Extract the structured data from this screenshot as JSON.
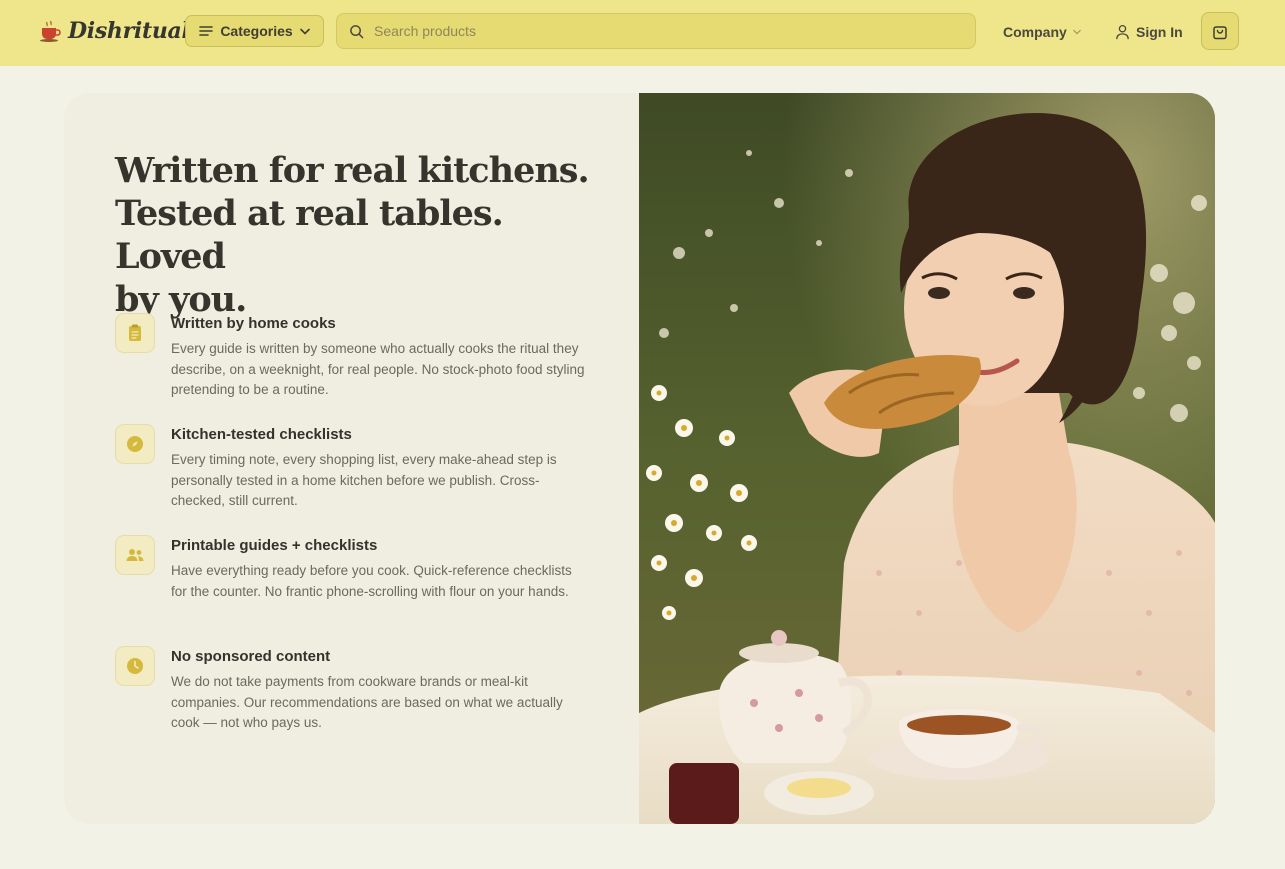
{
  "header": {
    "brand": "Dishritual",
    "categories_label": "Categories",
    "search_placeholder": "Search products",
    "company_label": "Company",
    "signin_label": "Sign In"
  },
  "hero": {
    "headline_line1": "Written for real kitchens.",
    "headline_line2": "Tested at real tables. Loved",
    "headline_line3": "by you."
  },
  "features": [
    {
      "icon": "clipboard-icon",
      "title": "Written by home cooks",
      "description": "Every guide is written by someone who actually cooks the ritual they describe, on a weeknight, for real people. No stock-photo food styling pretending to be a routine."
    },
    {
      "icon": "compass-icon",
      "title": "Kitchen-tested checklists",
      "description": "Every timing note, every shopping list, every make-ahead step is personally tested in a home kitchen before we publish. Cross-checked, still current."
    },
    {
      "icon": "users-icon",
      "title": "Printable guides + checklists",
      "description": "Have everything ready before you cook. Quick-reference checklists for the counter. No frantic phone-scrolling with flour on your hands."
    },
    {
      "icon": "clock-icon",
      "title": "No sponsored content",
      "description": "We do not take payments from cookware brands or meal-kit companies. Our recommendations are based on what we actually cook — not who pays us."
    }
  ],
  "colors": {
    "header_bg": "#efe58a",
    "page_bg": "#f3f2e7",
    "card_bg": "#efeee0",
    "accent": "#d4b93c"
  }
}
